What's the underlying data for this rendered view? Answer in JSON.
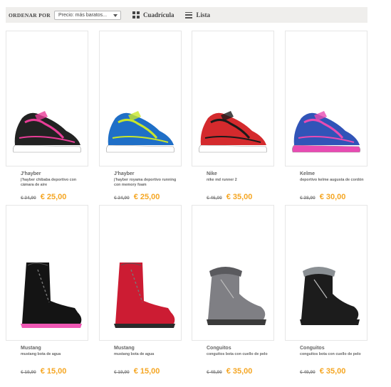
{
  "toolbar": {
    "sort_label": "ORDENAR POR",
    "sort_value": "Precio: más baratos...",
    "grid_label": "Cuadrícula",
    "list_label": "Lista"
  },
  "products": [
    {
      "brand": "J'hayber",
      "desc": "j'hayber chibaba deportivo con cámara de aire",
      "old_price": "€ 34,90",
      "price": "€ 25,00",
      "colors": [
        "#222222",
        "#e83d97",
        "#ffffff"
      ]
    },
    {
      "brand": "J'hayber",
      "desc": "j'hayber royama deportivo running con memory foam",
      "old_price": "€ 34,90",
      "price": "€ 25,00",
      "colors": [
        "#1f6fc7",
        "#c8e62a",
        "#ffffff"
      ]
    },
    {
      "brand": "Nike",
      "desc": "nike md runner 2",
      "old_price": "€ 46,00",
      "price": "€ 35,00",
      "colors": [
        "#d42a2d",
        "#1a1a1a",
        "#ffffff"
      ]
    },
    {
      "brand": "Kelme",
      "desc": "deportivo kelme augusta de cordón",
      "old_price": "€ 38,90",
      "price": "€ 30,00",
      "colors": [
        "#3154b8",
        "#e84bb3",
        "#e84bb3"
      ]
    },
    {
      "brand": "Mustang",
      "desc": "mustang bota de agua",
      "old_price": "€ 19,90",
      "price": "€ 15,00",
      "colors": [
        "#141414",
        "#ef57b4",
        "#ef57b4"
      ]
    },
    {
      "brand": "Mustang",
      "desc": "mustang bota de agua",
      "old_price": "€ 19,90",
      "price": "€ 15,00",
      "colors": [
        "#cc1c33",
        "#2a2a2a",
        "#2a2a2a"
      ]
    },
    {
      "brand": "Conguitos",
      "desc": "conguitos bota con cuello de pelo",
      "old_price": "€ 49,90",
      "price": "€ 35,00",
      "colors": [
        "#7f7f84",
        "#5a5a5e",
        "#3a3a3a"
      ]
    },
    {
      "brand": "Conguitos",
      "desc": "conguitos bota con cuello de pelo",
      "old_price": "€ 49,90",
      "price": "€ 35,00",
      "colors": [
        "#1c1c1c",
        "#8a8f93",
        "#1c1c1c"
      ]
    }
  ]
}
